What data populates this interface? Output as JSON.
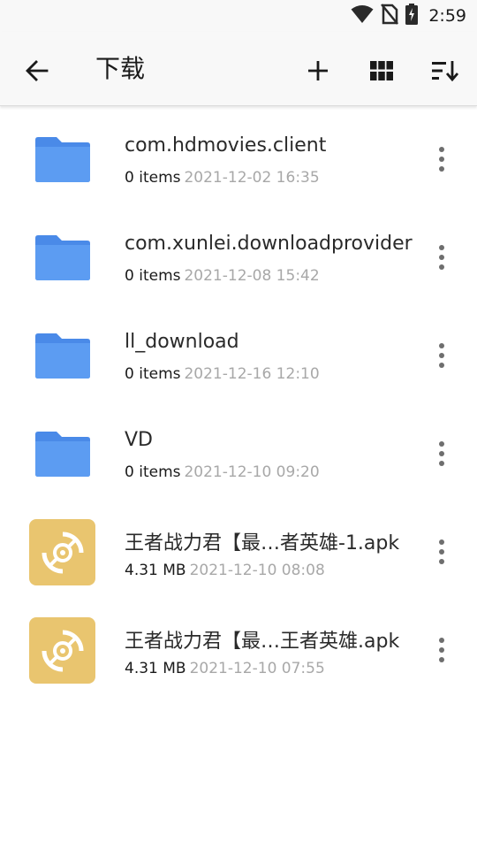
{
  "status_bar": {
    "time": "2:59",
    "icons": [
      "wifi-icon",
      "no-sim-icon",
      "battery-charging-icon"
    ]
  },
  "app_bar": {
    "title": "下载",
    "back_icon": "arrow-left-icon",
    "actions": [
      "add-icon",
      "grid-view-icon",
      "sort-icon"
    ]
  },
  "files": [
    {
      "type": "folder",
      "name": "com.hdmovies.client",
      "info": "0 items",
      "date": "2021-12-02 16:35"
    },
    {
      "type": "folder",
      "name": "com.xunlei.downloadprovider",
      "info": "0 items",
      "date": "2021-12-08 15:42"
    },
    {
      "type": "folder",
      "name": "ll_download",
      "info": "0 items",
      "date": "2021-12-16 12:10"
    },
    {
      "type": "folder",
      "name": "VD",
      "info": "0 items",
      "date": "2021-12-10 09:20"
    },
    {
      "type": "apk",
      "name": "王者战力君【最…者英雄-1.apk",
      "info": "4.31 MB",
      "date": "2021-12-10 08:08"
    },
    {
      "type": "apk",
      "name": "王者战力君【最…王者英雄.apk",
      "info": "4.31 MB",
      "date": "2021-12-10 07:55"
    }
  ],
  "colors": {
    "folder": "#5c9cf2",
    "apk_tile": "#e9c56f",
    "secondary_text": "#a8a8a8",
    "bar_background": "#f8f8f8"
  }
}
